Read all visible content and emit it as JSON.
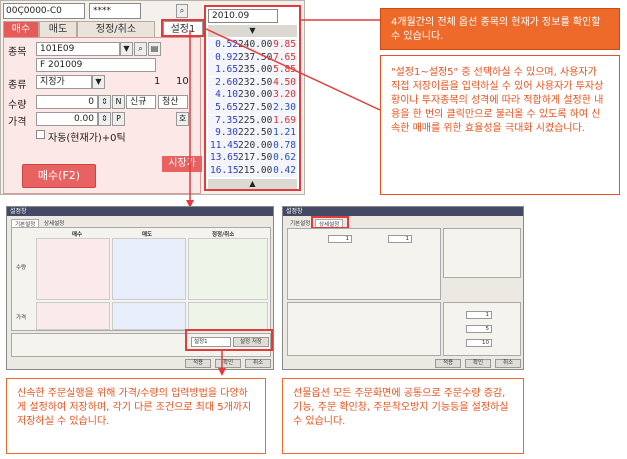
{
  "order": {
    "account": "00Ç0000-C0",
    "password": "****",
    "tabs": [
      "매수",
      "매도",
      "정정/취소",
      "설정1"
    ],
    "labels": {
      "code": "종목",
      "kind": "종류",
      "qty": "수량",
      "price": "가격"
    },
    "code": "101E09",
    "code_name": "F 201009",
    "kind_value": "지정가",
    "kind_n1": "1",
    "kind_n2": "10",
    "qty_value": "0",
    "qty_mode": "N",
    "qty_type": "신규",
    "qty_type2": "청산",
    "price_value": "0.00",
    "price_flag": "P",
    "price_flag2": "호",
    "auto_label": "자동(현재가)+0틱",
    "market_btn": "시장가",
    "buy_btn": "매수(F2)"
  },
  "ladder": {
    "month": "2010.09",
    "rows": [
      [
        "0.52",
        "240.00",
        "9.85"
      ],
      [
        "0.92",
        "237.50",
        "7.65"
      ],
      [
        "1.65",
        "235.00",
        "5.85"
      ],
      [
        "2.60",
        "232.50",
        "4.50"
      ],
      [
        "4.10",
        "230.00",
        "3.20"
      ],
      [
        "5.65",
        "227.50",
        "2.30"
      ],
      [
        "7.35",
        "225.00",
        "1.69"
      ],
      [
        "9.30",
        "222.50",
        "1.21"
      ],
      [
        "11.45",
        "220.00",
        "0.78"
      ],
      [
        "13.65",
        "217.50",
        "0.62"
      ],
      [
        "16.15",
        "215.00",
        "0.42"
      ]
    ],
    "red_flags": [
      true,
      true,
      true,
      true,
      true,
      false,
      true,
      false,
      false,
      false,
      false
    ]
  },
  "callouts": {
    "top": "4개월간의 전체 옵션 종목의 현재가 정보를 확인할 수 있습니다.",
    "middle": "\"설정1~설정5\" 중 선택하실 수 있으며, 사용자가 직접 저장이름을 입력하실 수 있어 사용자가 투자상황이나 투자종목의 성격에 따라 적합하게 설정한 내용을 한 번의 클릭만으로 불러올 수 있도록 하여 신속한 매매를 위한 효율성을 극대화 시켰습니다.",
    "bottom_left": "신속한 주문실행을 위해 가격/수량의 입력방법을 다양하게 설정하여 저장하며, 각기 다른 조건으로 최대 5개까지 저장하실 수 있습니다.",
    "bottom_right": "선물옵션 모든 주문화면에 공통으로 주문수량 증감, 기능, 주문 확인창, 주문착오방지 기능등을 설정하실 수 있습니다."
  },
  "dialog_left": {
    "title": "설정창",
    "tabs": [
      "기본설정",
      "상세설정"
    ],
    "cols": [
      "매수",
      "매도",
      "정정/취소"
    ],
    "rows": [
      "수량",
      "가격"
    ],
    "save_label": "설정1",
    "save_btn": "설정 저장",
    "ok": "적용",
    "confirm": "확인",
    "cancel": "취소"
  },
  "dialog_right": {
    "title": "설정창",
    "tabs": [
      "기본설정",
      "상세설정"
    ],
    "qty_a": "1",
    "qty_b": "1",
    "side_vals": [
      "1",
      "5",
      "10"
    ],
    "ok": "적용",
    "confirm": "확인",
    "cancel": "취소"
  },
  "colors": {
    "accent": "#ee6a2a",
    "red": "#e23b3b",
    "buy": "#e65a5a"
  }
}
